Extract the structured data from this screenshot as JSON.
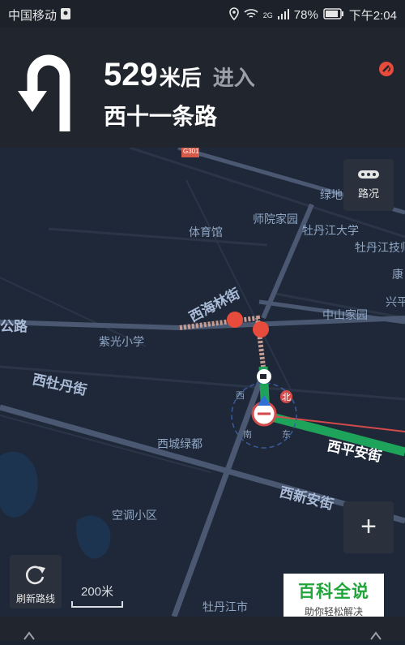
{
  "status_bar": {
    "carrier": "中国移动",
    "network": "2G",
    "battery": "78%",
    "time": "下午2:04"
  },
  "navigation": {
    "distance": "529",
    "unit": "米后",
    "action": "进入",
    "road": "西十一条路"
  },
  "map": {
    "places": [
      "体育馆",
      "师院家园",
      "牡丹江大学",
      "绿地",
      "牡丹江技师",
      "康",
      "中山家园",
      "兴平",
      "紫光小学",
      "西城绿都",
      "空调小区",
      "牡丹江市"
    ],
    "roads": [
      "公路",
      "西海林街",
      "西牡丹街",
      "西平安街",
      "西新安街",
      "G301",
      "北"
    ],
    "compass_labels": [
      "西",
      "南",
      "东"
    ]
  },
  "traffic_button": {
    "label": "路况"
  },
  "refresh_button": {
    "label": "刷新路线"
  },
  "scale": {
    "label": "200米"
  },
  "zoom": {
    "in_label": "+"
  },
  "watermark": {
    "title": "百科全说",
    "subtitle": "助你轻松解决"
  }
}
